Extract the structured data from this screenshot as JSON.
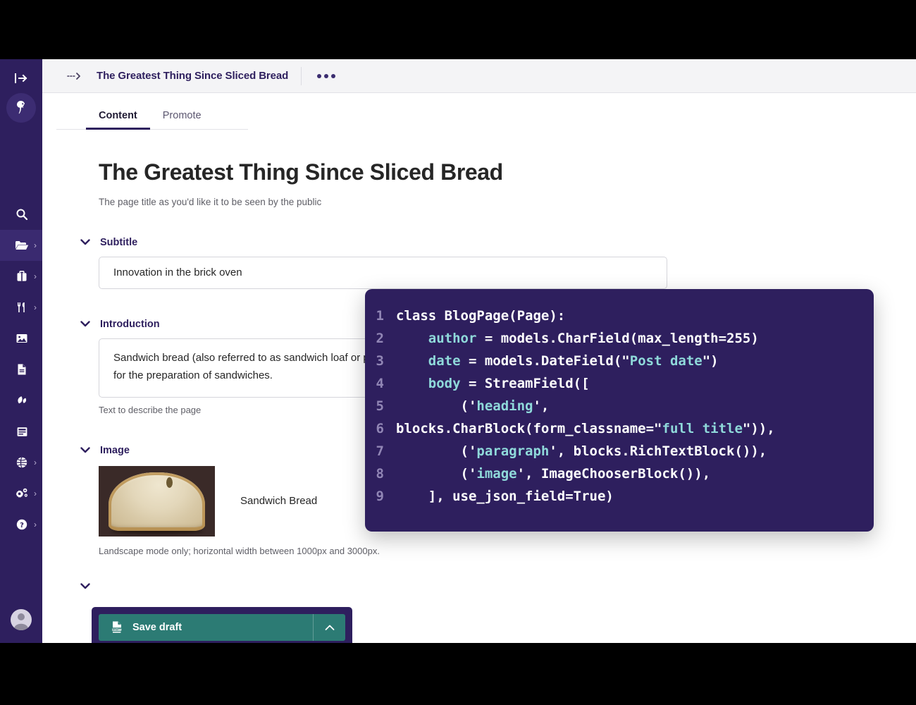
{
  "colors": {
    "sidebar_bg": "#2E1F5E",
    "sidebar_active": "#3A2A70",
    "header_bg": "#F4F4F6",
    "accent_purple": "#2E1F5E",
    "teal_button": "#2C7B74",
    "code_bg": "#2E1F5E",
    "code_string": "#8FD9DA",
    "code_linenum": "#9186B5",
    "help_text": "#5F5F67"
  },
  "sidebar": {
    "toggle": {
      "name": "toggle-sidebar",
      "icon": "sidebar-expand-icon"
    },
    "logo": {
      "name": "wagtail-logo",
      "icon": "wagtail-bird-icon"
    },
    "items": [
      {
        "label": "Search",
        "icon": "search-icon",
        "has_arrow": false,
        "active": false
      },
      {
        "label": "Pages",
        "icon": "folder-open-icon",
        "has_arrow": true,
        "active": true
      },
      {
        "label": "Shop",
        "icon": "briefcase-icon",
        "has_arrow": true,
        "active": false
      },
      {
        "label": "Recipes",
        "icon": "fork-knife-icon",
        "has_arrow": true,
        "active": false
      },
      {
        "label": "Images",
        "icon": "image-icon",
        "has_arrow": false,
        "active": false
      },
      {
        "label": "Documents",
        "icon": "document-icon",
        "has_arrow": false,
        "active": false
      },
      {
        "label": "Snippets",
        "icon": "leaf-icon",
        "has_arrow": false,
        "active": false
      },
      {
        "label": "Forms",
        "icon": "form-icon",
        "has_arrow": false,
        "active": false
      },
      {
        "label": "Locales",
        "icon": "globe-icon",
        "has_arrow": true,
        "active": false
      },
      {
        "label": "Settings",
        "icon": "gears-icon",
        "has_arrow": true,
        "active": false
      },
      {
        "label": "Help",
        "icon": "question-circle-icon",
        "has_arrow": true,
        "active": false
      }
    ],
    "avatar": {
      "name": "user-avatar",
      "icon": "avatar-icon"
    }
  },
  "header": {
    "breadcrumb_icon": "dotted-arrow-right-icon",
    "title": "The Greatest Thing Since Sliced Bread",
    "more_icon": "ellipsis-icon"
  },
  "tabs": [
    {
      "label": "Content",
      "active": true
    },
    {
      "label": "Promote",
      "active": false
    }
  ],
  "form": {
    "page_title": "The Greatest Thing Since Sliced Bread",
    "page_title_help": "The page title as you'd like it to be seen by the public",
    "subtitle": {
      "label": "Subtitle",
      "value": "Innovation in the brick oven"
    },
    "introduction": {
      "label": "Introduction",
      "value": "Sandwich bread (also referred to as sandwich loaf or pan bread) is bread that is prepared specifically to be used for the preparation of sandwiches.",
      "help": "Text to describe the page"
    },
    "image": {
      "label": "Image",
      "title": "Sandwich Bread",
      "help": "Landscape mode only; horizontal width between 1000px and 3000px."
    }
  },
  "footer": {
    "save_draft_label": "Save draft",
    "save_draft_icon": "draft-document-icon",
    "split_icon": "chevron-up-icon"
  },
  "code_overlay": {
    "lines": [
      {
        "n": "1",
        "parts": [
          {
            "t": "class BlogPage(Page):",
            "c": "plain"
          }
        ]
      },
      {
        "n": "2",
        "parts": [
          {
            "t": "    ",
            "c": "plain"
          },
          {
            "t": "author",
            "c": "acc"
          },
          {
            "t": " = models.CharField(max_length=255)",
            "c": "plain"
          }
        ]
      },
      {
        "n": "3",
        "parts": [
          {
            "t": "    ",
            "c": "plain"
          },
          {
            "t": "date",
            "c": "acc"
          },
          {
            "t": " = models.DateField(\"",
            "c": "plain"
          },
          {
            "t": "Post date",
            "c": "acc"
          },
          {
            "t": "\")",
            "c": "plain"
          }
        ]
      },
      {
        "n": "4",
        "parts": [
          {
            "t": "    ",
            "c": "plain"
          },
          {
            "t": "body",
            "c": "acc"
          },
          {
            "t": " = StreamField([",
            "c": "plain"
          }
        ]
      },
      {
        "n": "5",
        "parts": [
          {
            "t": "        ('",
            "c": "plain"
          },
          {
            "t": "heading",
            "c": "acc"
          },
          {
            "t": "',",
            "c": "plain"
          }
        ]
      },
      {
        "n": "6",
        "parts": [
          {
            "t": "blocks.CharBlock(form_classname=\"",
            "c": "plain"
          },
          {
            "t": "full title",
            "c": "acc"
          },
          {
            "t": "\")),",
            "c": "plain"
          }
        ]
      },
      {
        "n": "7",
        "parts": [
          {
            "t": "        ('",
            "c": "plain"
          },
          {
            "t": "paragraph",
            "c": "acc"
          },
          {
            "t": "', blocks.RichTextBlock()),",
            "c": "plain"
          }
        ]
      },
      {
        "n": "8",
        "parts": [
          {
            "t": "        ('",
            "c": "plain"
          },
          {
            "t": "image",
            "c": "acc"
          },
          {
            "t": "', ImageChooserBlock()),",
            "c": "plain"
          }
        ]
      },
      {
        "n": "9",
        "parts": [
          {
            "t": "    ], use_json_field=True)",
            "c": "plain"
          }
        ]
      }
    ]
  }
}
